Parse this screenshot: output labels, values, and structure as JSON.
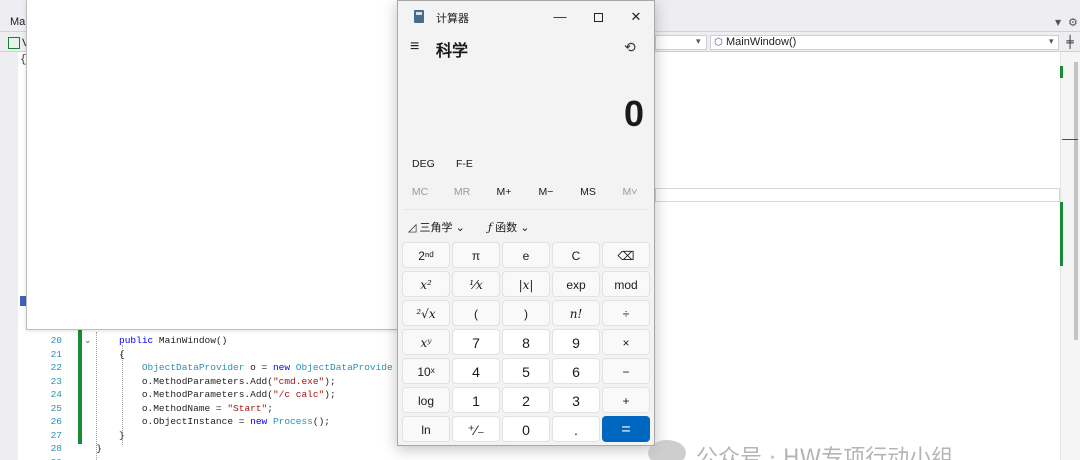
{
  "ide": {
    "tab_label": "Ma",
    "context_label": "V",
    "member_dropdown": "MainWindow()",
    "code_lines": [
      {
        "num": "20",
        "segs": [
          {
            "t": "        "
          },
          {
            "t": "public",
            "c": "kw"
          },
          {
            "t": " MainWindow()"
          }
        ]
      },
      {
        "num": "21",
        "segs": [
          {
            "t": "        {"
          }
        ]
      },
      {
        "num": "22",
        "segs": [
          {
            "t": "            "
          },
          {
            "t": "ObjectDataProvider",
            "c": "ty"
          },
          {
            "t": " o = "
          },
          {
            "t": "new",
            "c": "kw"
          },
          {
            "t": " "
          },
          {
            "t": "ObjectDataProvide",
            "c": "ty"
          }
        ]
      },
      {
        "num": "23",
        "segs": [
          {
            "t": "            o.MethodParameters.Add("
          },
          {
            "t": "\"cmd.exe\"",
            "c": "st"
          },
          {
            "t": ");"
          }
        ]
      },
      {
        "num": "24",
        "segs": [
          {
            "t": "            o.MethodParameters.Add("
          },
          {
            "t": "\"/c calc\"",
            "c": "st"
          },
          {
            "t": ");"
          }
        ]
      },
      {
        "num": "25",
        "segs": [
          {
            "t": "            o.MethodName = "
          },
          {
            "t": "\"Start\"",
            "c": "st"
          },
          {
            "t": ";"
          }
        ]
      },
      {
        "num": "26",
        "segs": [
          {
            "t": "            o.ObjectInstance = "
          },
          {
            "t": "new",
            "c": "kw"
          },
          {
            "t": " "
          },
          {
            "t": "Process",
            "c": "ty"
          },
          {
            "t": "();"
          }
        ]
      },
      {
        "num": "27",
        "segs": [
          {
            "t": "        }"
          }
        ]
      },
      {
        "num": "28",
        "segs": [
          {
            "t": "    }"
          }
        ]
      },
      {
        "num": "29",
        "segs": [
          {
            "t": ""
          }
        ]
      }
    ]
  },
  "calculator": {
    "title": "计算器",
    "mode": "科学",
    "display": "0",
    "angle_unit": "DEG",
    "notation": "F-E",
    "memory": [
      {
        "label": "MC",
        "enabled": false
      },
      {
        "label": "MR",
        "enabled": false
      },
      {
        "label": "M+",
        "enabled": true
      },
      {
        "label": "M−",
        "enabled": true
      },
      {
        "label": "MS",
        "enabled": true
      },
      {
        "label": "M˅",
        "enabled": false
      }
    ],
    "trig_label": "三角学",
    "func_label": "函数",
    "keys": [
      [
        "2ⁿᵈ",
        "π",
        "e",
        "C",
        "⌫"
      ],
      [
        "x²",
        "¹⁄x",
        "|x|",
        "exp",
        "mod"
      ],
      [
        "²√x",
        "(",
        ")",
        "n!",
        "÷"
      ],
      [
        "xʸ",
        "7",
        "8",
        "9",
        "×"
      ],
      [
        "10ˣ",
        "4",
        "5",
        "6",
        "−"
      ],
      [
        "log",
        "1",
        "2",
        "3",
        "+"
      ],
      [
        "ln",
        "⁺⁄₋",
        "0",
        ".",
        "="
      ]
    ]
  },
  "watermark": {
    "text": "公众号 · HW专项行动小组"
  }
}
